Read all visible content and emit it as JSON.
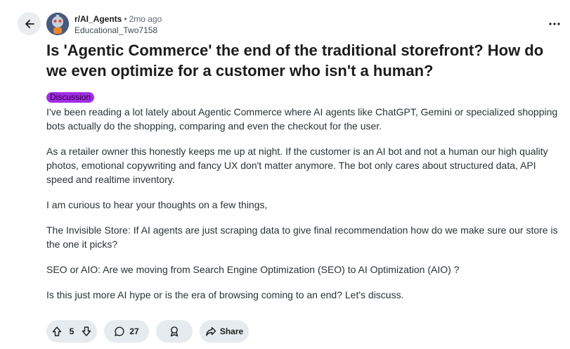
{
  "post": {
    "community": "r/AI_Agents",
    "separator": "•",
    "time": "2mo ago",
    "author": "Educational_Two7158",
    "title": "Is 'Agentic Commerce' the end of the traditional storefront? How do we even optimize for a customer who isn't a human?",
    "flair": "Discussion",
    "paragraphs": [
      "I've been reading a lot lately about Agentic Commerce where AI agents like ChatGPT, Gemini or specialized shopping bots actually do the shopping, comparing and even the checkout for the user.",
      "As a retailer owner this honestly keeps me up at night. If the customer is an AI bot and not a human our high quality photos, emotional copywriting and fancy UX don't matter anymore. The bot only cares about structured data, API speed and realtime inventory.",
      "I am curious to hear your thoughts on a few things,",
      "The Invisible Store: If AI agents are just scraping data to give final recommendation how do we make sure our store is the one it picks?",
      "SEO or AIO: Are we moving from Search Engine Optimization (SEO) to AI Optimization (AIO) ?",
      "Is this just more AI hype or is the era of browsing coming to an end? Let's discuss."
    ]
  },
  "actions": {
    "vote_count": "5",
    "comment_count": "27",
    "share_label": "Share"
  },
  "icons": {
    "back": "arrow-left-icon",
    "more": "more-horizontal-icon",
    "upvote": "upvote-arrow-icon",
    "downvote": "downvote-arrow-icon",
    "comment": "comment-bubble-icon",
    "award": "award-icon",
    "share": "share-arrow-icon"
  },
  "colors": {
    "flair_bg": "#a12de6",
    "pill_bg": "#e5ebee",
    "back_bg": "#eaedef"
  }
}
